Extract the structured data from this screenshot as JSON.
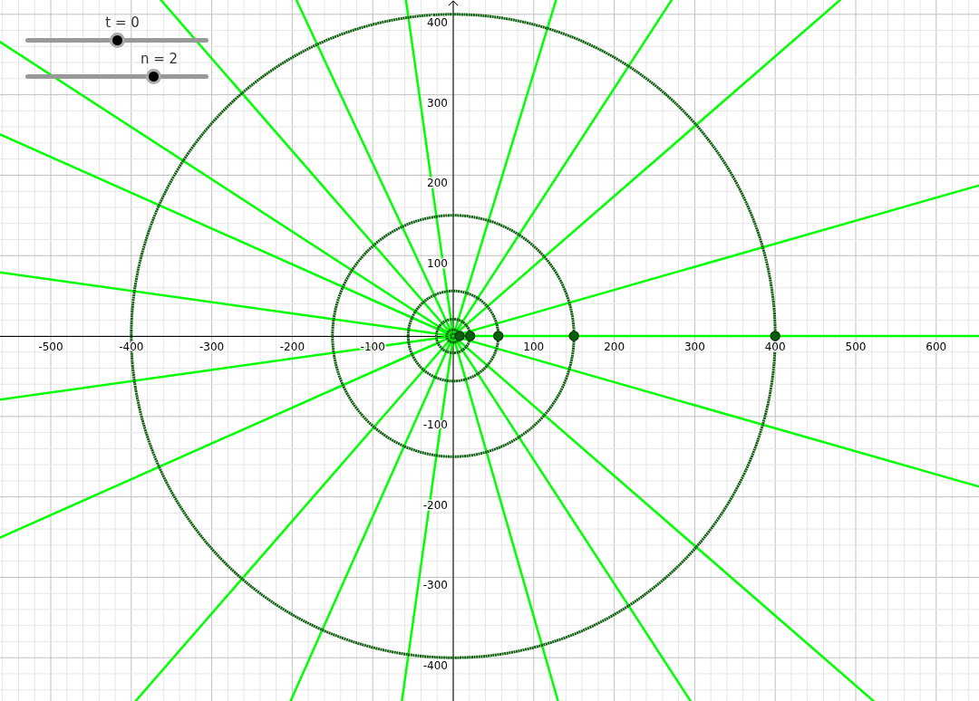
{
  "sliders": [
    {
      "label": "t = 0",
      "level": 0.5
    },
    {
      "label": "n = 2",
      "level": 0.7
    }
  ],
  "graphics_view": {
    "x_axis_labels": [
      "-500",
      "-400",
      "-300",
      "-200",
      "-100",
      "100",
      "200",
      "300",
      "400",
      "500",
      "600"
    ],
    "y_axis_labels": [
      "400",
      "300",
      "200",
      "100",
      "-100",
      "-200",
      "-300",
      "-400"
    ]
  }
}
